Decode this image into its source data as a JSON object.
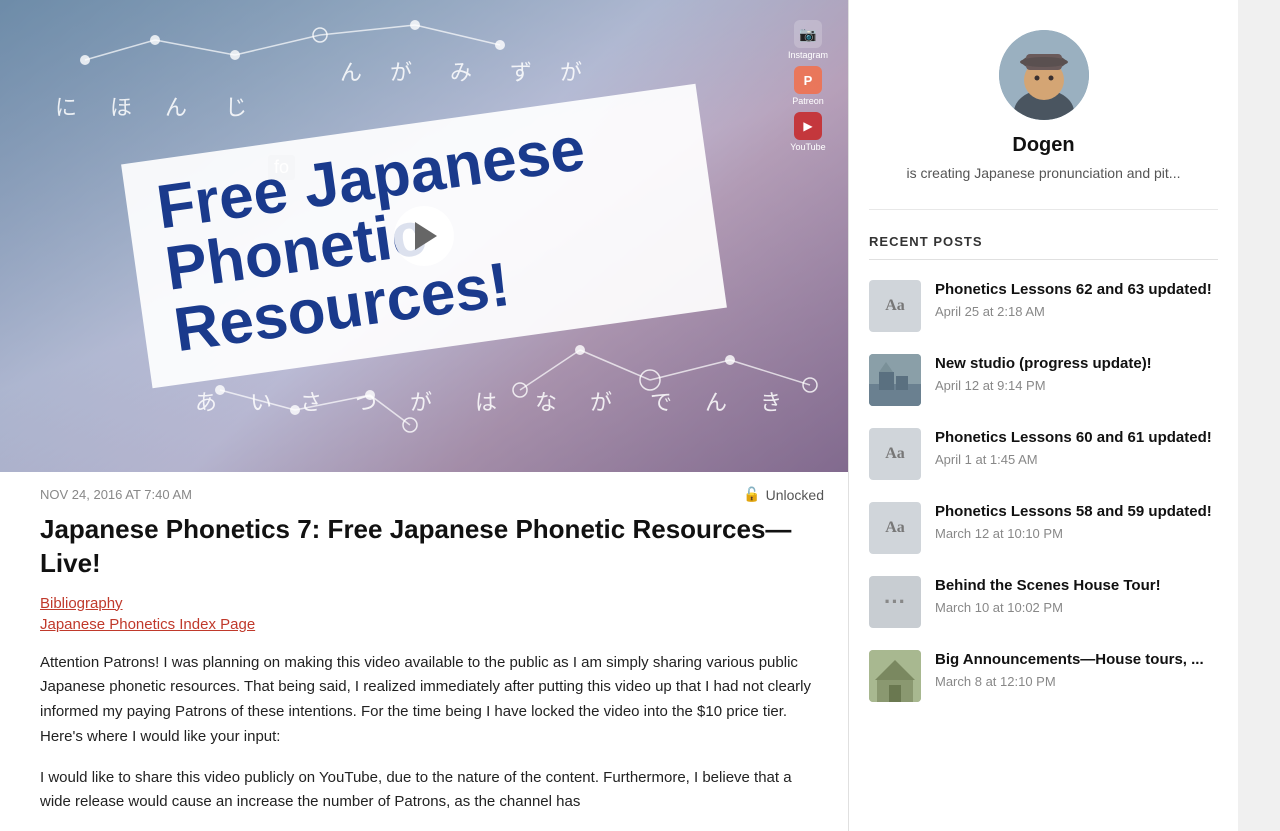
{
  "video": {
    "banner_line1": "Free Japanese",
    "banner_line2": "Phonetic Resources!",
    "jp_chars_top": [
      "に",
      "ほ",
      "ん",
      "じ",
      "ん",
      "が",
      "み",
      "ず",
      "が"
    ],
    "jp_chars_bottom": [
      "あ",
      "い",
      "さ",
      "つ",
      "が",
      "は",
      "な",
      "が",
      "で",
      "ん",
      "き"
    ],
    "fo_label": "fo",
    "social": [
      {
        "name": "Instagram",
        "symbol": "📷"
      },
      {
        "name": "Patreon",
        "symbol": "P"
      },
      {
        "name": "YouTube",
        "symbol": "▶"
      }
    ]
  },
  "post": {
    "date": "NOV 24, 2016 AT 7:40 AM",
    "unlocked_label": "Unlocked",
    "title": "Japanese Phonetics 7: Free Japanese Phonetic Resources—Live!",
    "link1": "Bibliography",
    "link2": "Japanese Phonetics Index Page",
    "body_p1": "Attention Patrons! I was planning on making this video available to the public as I am simply sharing  various public Japanese phonetic resources. That being said, I realized immediately after putting this video up that I had not clearly informed my paying Patrons of these intentions. For the time being I have locked the video into the $10 price tier. Here's where I would like your input:",
    "body_p2": "I would like to share this video publicly on YouTube, due to the nature of the content. Furthermore, I believe that a wide release would cause an increase the number of Patrons, as the channel has"
  },
  "sidebar": {
    "author_name": "Dogen",
    "author_description": "is creating Japanese pronunciation and pit...",
    "recent_posts_title": "RECENT POSTS",
    "posts": [
      {
        "id": 1,
        "thumb_type": "text",
        "thumb_label": "Aa",
        "title": "Phonetics Lessons 62 and 63 updated!",
        "date": "April 25 at 2:18 AM"
      },
      {
        "id": 2,
        "thumb_type": "photo",
        "thumb_label": "🏠",
        "title": "New studio (progress update)!",
        "date": "April 12 at 9:14 PM"
      },
      {
        "id": 3,
        "thumb_type": "text",
        "thumb_label": "Aa",
        "title": "Phonetics Lessons 60 and 61 updated!",
        "date": "April 1 at 1:45 AM"
      },
      {
        "id": 4,
        "thumb_type": "text",
        "thumb_label": "Aa",
        "title": "Phonetics Lessons 58 and 59 updated!",
        "date": "March 12 at 10:10 PM"
      },
      {
        "id": 5,
        "thumb_type": "dots",
        "thumb_label": "···",
        "title": "Behind the Scenes House Tour!",
        "date": "March 10 at 10:02 PM"
      },
      {
        "id": 6,
        "thumb_type": "house",
        "thumb_label": "🏡",
        "title": "Big Announcements—House tours, ...",
        "date": "March 8 at 12:10 PM"
      }
    ]
  }
}
